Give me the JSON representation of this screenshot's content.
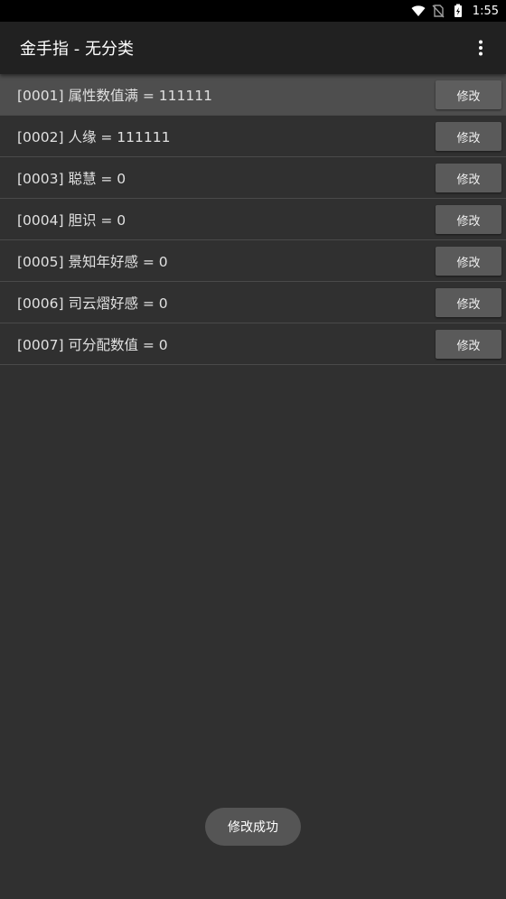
{
  "status_bar": {
    "time": "1:55",
    "icons": [
      "wifi-icon",
      "no-sim-icon",
      "battery-charging-icon"
    ]
  },
  "app_bar": {
    "title": "金手指 - 无分类",
    "menu_icon": "more-vert-icon"
  },
  "list": {
    "button_label": "修改",
    "items": [
      {
        "label": "[0001] 属性数值满 = 111111",
        "highlighted": true
      },
      {
        "label": "[0002] 人缘 = 111111",
        "highlighted": false
      },
      {
        "label": "[0003] 聪慧 = 0",
        "highlighted": false
      },
      {
        "label": "[0004] 胆识 = 0",
        "highlighted": false
      },
      {
        "label": "[0005] 景知年好感 = 0",
        "highlighted": false
      },
      {
        "label": "[0006] 司云熠好感 = 0",
        "highlighted": false
      },
      {
        "label": "[0007] 可分配数值 = 0",
        "highlighted": false
      }
    ]
  },
  "toast": {
    "message": "修改成功"
  },
  "colors": {
    "background": "#303030",
    "app_bar": "#212121",
    "highlight_row": "#4e4e4e",
    "button": "#5a5a5a",
    "divider": "#4a4a4a"
  }
}
